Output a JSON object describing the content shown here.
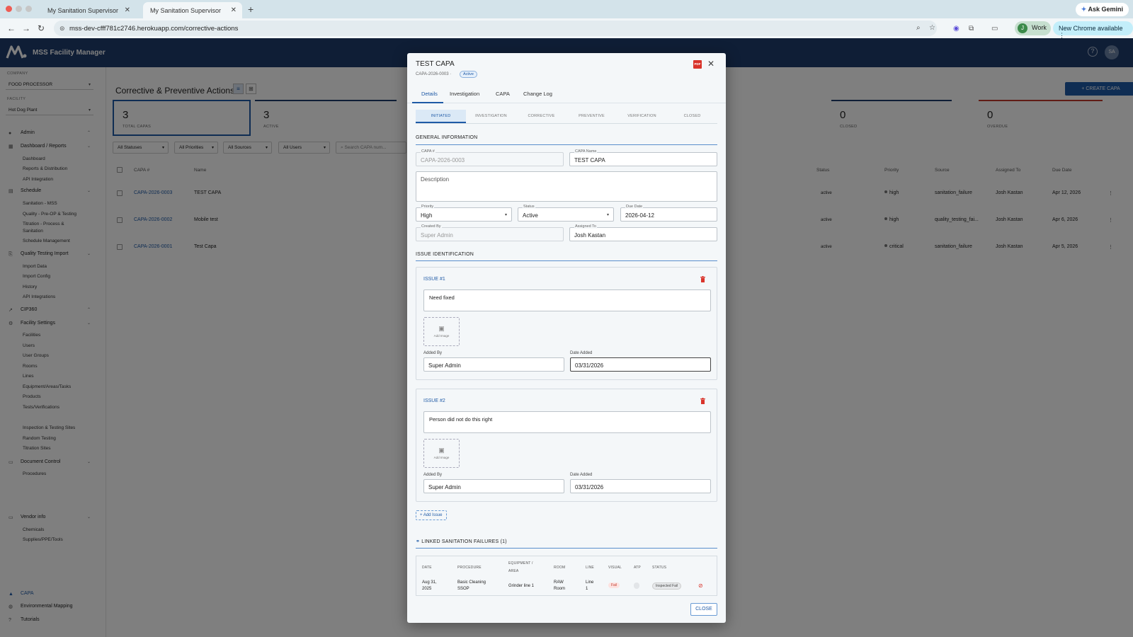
{
  "browser": {
    "tabs": [
      {
        "label": "My Sanitation Supervisor"
      },
      {
        "label": "My Sanitation Supervisor"
      }
    ],
    "url": "mss-dev-cfff781c2746.herokuapp.com/corrective-actions",
    "ask_gemini": "Ask Gemini",
    "profile": "Work",
    "profile_initial": "J",
    "update_label": "New Chrome available"
  },
  "app": {
    "name": "MSS Facility Manager",
    "user_initials": "SA",
    "help": "?"
  },
  "sidebar": {
    "company_label": "COMPANY",
    "company_value": "FOOD PROCESSOR",
    "facility_label": "FACILITY",
    "facility_value": "Hot Dog Plant",
    "groups": [
      {
        "label": "Admin"
      },
      {
        "label": "Dashboard / Reports",
        "items": [
          "Dashboard",
          "Reports & Distribution",
          "API Integration"
        ]
      },
      {
        "label": "Schedule",
        "items": [
          "Sanitation - MSS",
          "Quality - Pre-OP & Testing",
          "Titration - Process &",
          "Sanitation",
          "Schedule Management"
        ]
      },
      {
        "label": "Quality Testing Import",
        "items": [
          "Import Data",
          "Import Config",
          "History",
          "API Integrations"
        ]
      },
      {
        "label": "CIP360"
      },
      {
        "label": "Facility Settings",
        "items": [
          "Facilities",
          "Users",
          "User Groups",
          "Rooms",
          "Lines",
          "Equipment/Areas/Tasks",
          "Products",
          "Tests/Verifications",
          "Inspection & Testing Sites",
          "Random Testing",
          "Titration Sites"
        ]
      },
      {
        "label": "Document Control",
        "items": [
          "Procedures"
        ]
      },
      {
        "label": "Vendor info",
        "items": [
          "Chemicals",
          "Supplies/PPE/Tools"
        ]
      },
      {
        "label": "CAPA"
      },
      {
        "label": "Environmental Mapping"
      },
      {
        "label": "Tutorials"
      }
    ]
  },
  "page": {
    "title": "Corrective & Preventive Actions",
    "create_button": "+ CREATE CAPA",
    "cards": [
      {
        "num": "3",
        "label": "TOTAL CAPAS"
      },
      {
        "num": "3",
        "label": "ACTIVE"
      },
      {
        "num": "0",
        "label": "CLOSED"
      },
      {
        "num": "0",
        "label": "OVERDUE"
      }
    ],
    "filters": [
      "All Statuses",
      "All Priorities",
      "All Sources",
      "All Users"
    ],
    "search_placeholder": "Search CAPA num...",
    "columns": [
      "CAPA #",
      "Name",
      "Status",
      "Priority",
      "Source",
      "Assigned To",
      "Due Date"
    ],
    "rows": [
      {
        "id": "CAPA-2026-0003",
        "name": "TEST CAPA",
        "status": "active",
        "priority": "high",
        "source": "sanitation_failure",
        "assigned": "Josh Kastan",
        "due": "Apr 12, 2026"
      },
      {
        "id": "CAPA-2026-0002",
        "name": "Mobile test",
        "status": "active",
        "priority": "high",
        "source": "quality_testing_fai...",
        "assigned": "Josh Kastan",
        "due": "Apr 6, 2026"
      },
      {
        "id": "CAPA-2026-0001",
        "name": "Test Capa",
        "status": "active",
        "priority": "critical",
        "source": "sanitation_failure",
        "assigned": "Josh Kastan",
        "due": "Apr 5, 2026"
      }
    ]
  },
  "modal": {
    "title": "TEST CAPA",
    "subtitle": "CAPA-2026-0003 ·",
    "badge": "Active",
    "pdf_label": "PDF",
    "tabs": [
      "Details",
      "Investigation",
      "CAPA",
      "Change Log"
    ],
    "steps": [
      "INITIATED",
      "INVESTIGATION",
      "CORRECTIVE",
      "PREVENTIVE",
      "VERIFICATION",
      "CLOSED"
    ],
    "general_title": "GENERAL INFORMATION",
    "fields": {
      "capa_no_label": "CAPA #",
      "capa_no": "CAPA-2026-0003",
      "name_label": "CAPA Name",
      "name": "TEST CAPA",
      "description_label": "Description",
      "priority_label": "Priority",
      "priority": "High",
      "status_label": "Status",
      "status": "Active",
      "due_label": "Due Date",
      "due": "2026-04-12",
      "created_label": "Created By",
      "created": "Super Admin",
      "assigned_label": "Assigned To",
      "assigned": "Josh Kastan"
    },
    "issue_title": "ISSUE IDENTIFICATION",
    "issues": [
      {
        "title": "ISSUE #1",
        "text": "Need fixed",
        "add_image": "Add Image",
        "added_by_label": "Added By",
        "added_by": "Super Admin",
        "date_label": "Date Added",
        "date": "03/31/2026"
      },
      {
        "title": "ISSUE #2",
        "text": "Person did not do this right",
        "add_image": "Add Image",
        "added_by_label": "Added By",
        "added_by": "Super Admin",
        "date_label": "Date Added",
        "date": "03/31/2026"
      }
    ],
    "add_issue": "+ Add Issue",
    "linked_title": "LINKED SANITATION FAILURES (1)",
    "linked_columns": [
      "DATE",
      "PROCEDURE",
      "EQUIPMENT /",
      "AREA",
      "ROOM",
      "LINE",
      "VISUAL",
      "ATP",
      "STATUS"
    ],
    "linked_row": {
      "date1": "Aug 31,",
      "date2": "2025",
      "proc1": "Basic Cleaning",
      "proc2": "SSOP",
      "equipment": "Grinder line 1",
      "room1": "RAW",
      "room2": "Room",
      "line1": "Line",
      "line2": "1",
      "visual": "Fail",
      "status": "Inspected Fail"
    },
    "close": "CLOSE"
  },
  "colors": {
    "brand": "#1f3c6d",
    "accent": "#1f5aa6",
    "danger": "#d9342b"
  }
}
